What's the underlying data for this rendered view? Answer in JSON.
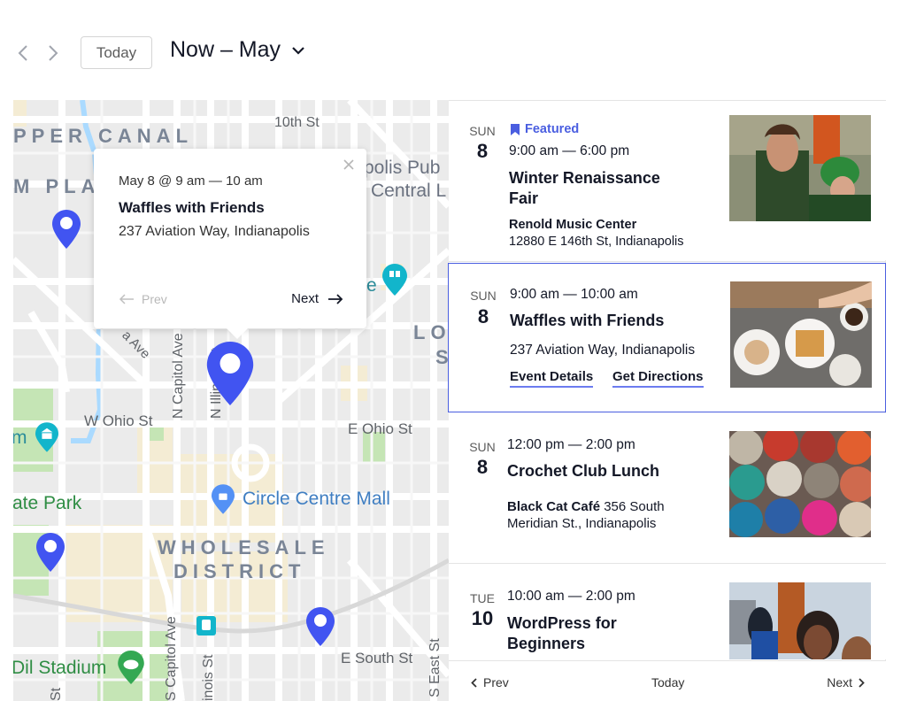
{
  "header": {
    "prev_label": "Previous",
    "next_label": "Next",
    "today_label": "Today",
    "range_label": "Now – May"
  },
  "colors": {
    "accent": "#4a5ee0",
    "pin": "#4154f1",
    "map_bg": "#ebebeb",
    "park": "#c5e5b5",
    "poi_teal": "#12b5cb"
  },
  "map": {
    "labels": {
      "upper_canal": "PPER CANAL",
      "place": "M PLAC",
      "tenth_st": "10th St",
      "library_1": "polis Pub",
      "library_2": "Central L",
      "lockerbie_1": "LO",
      "lockerbie_2": "S",
      "park_e": "e",
      "indiana_ave": "a Ave",
      "n_capitol": "N Capitol Ave",
      "n_illinois": "N Illinois St",
      "w_ohio": "W Ohio St",
      "e_ohio": "E Ohio St",
      "museum_m": "m",
      "state_park": "ate Park",
      "circle_centre": "Circle Centre Mall",
      "wholesale": "WHOLESALE",
      "district": "DISTRICT",
      "s_east_st": "S East St",
      "s_capitol": "S Capitol Ave",
      "s_illinois": "inois St",
      "e_south_st": "E South St",
      "stadium": "Dil Stadium",
      "st_fragment": "St"
    },
    "popup": {
      "date": "May 8 @ 9 am — 10 am",
      "title": "Waffles with Friends",
      "address": "237 Aviation Way, Indianapolis",
      "prev_label": "Prev",
      "next_label": "Next"
    }
  },
  "events": [
    {
      "dow": "SUN",
      "day": "8",
      "featured_label": "Featured",
      "time": "9:00 am — 6:00 pm",
      "title": "Winter Renaissance Fair",
      "venue_name": "Renold Music Center",
      "venue_address": "12880 E 146th St, Indianapolis",
      "image": "renaissance-fair-photo"
    },
    {
      "dow": "SUN",
      "day": "8",
      "time": "9:00 am — 10:00 am",
      "title": "Waffles with Friends",
      "venue_address": "237 Aviation Way, Indianapolis",
      "details_label": "Event Details",
      "directions_label": "Get Directions",
      "image": "waffles-photo",
      "selected": true
    },
    {
      "dow": "SUN",
      "day": "8",
      "time": "12:00 pm — 2:00 pm",
      "title": "Crochet Club Lunch",
      "venue_name": "Black Cat Café",
      "venue_address": "356 South Meridian St., Indianapolis",
      "image": "yarn-photo"
    },
    {
      "dow": "TUE",
      "day": "10",
      "time": "10:00 am — 2:00 pm",
      "title": "WordPress for Beginners",
      "image": "workshop-photo"
    }
  ],
  "list_footer": {
    "prev_label": "Prev",
    "today_label": "Today",
    "next_label": "Next"
  }
}
